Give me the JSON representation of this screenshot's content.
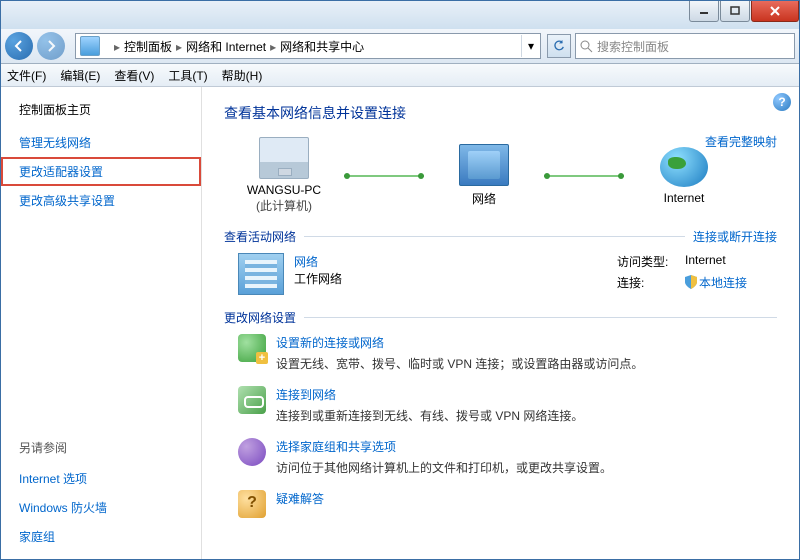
{
  "titlebar": {
    "min": "min",
    "max": "max",
    "close": "close"
  },
  "nav": {
    "crumbs": [
      "控制面板",
      "网络和 Internet",
      "网络和共享中心"
    ],
    "search_placeholder": "搜索控制面板"
  },
  "menu": {
    "file": "文件(F)",
    "edit": "编辑(E)",
    "view": "查看(V)",
    "tools": "工具(T)",
    "help": "帮助(H)"
  },
  "sidebar": {
    "home": "控制面板主页",
    "items": [
      "管理无线网络",
      "更改适配器设置",
      "更改高级共享设置"
    ],
    "seealso_header": "另请参阅",
    "seealso": [
      "Internet 选项",
      "Windows 防火墙",
      "家庭组"
    ]
  },
  "main": {
    "title": "查看基本网络信息并设置连接",
    "map_link": "查看完整映射",
    "nodes": {
      "pc": {
        "label": "WANGSU-PC",
        "sub": "(此计算机)"
      },
      "net": {
        "label": "网络"
      },
      "internet": {
        "label": "Internet"
      }
    },
    "active": {
      "header": "查看活动网络",
      "right_link": "连接或断开连接",
      "name": "网络",
      "type": "工作网络",
      "props": {
        "access_k": "访问类型:",
        "access_v": "Internet",
        "conn_k": "连接:",
        "conn_v": "本地连接"
      }
    },
    "change": {
      "header": "更改网络设置",
      "tasks": [
        {
          "name": "设置新的连接或网络",
          "desc": "设置无线、宽带、拨号、临时或 VPN 连接；或设置路由器或访问点。"
        },
        {
          "name": "连接到网络",
          "desc": "连接到或重新连接到无线、有线、拨号或 VPN 网络连接。"
        },
        {
          "name": "选择家庭组和共享选项",
          "desc": "访问位于其他网络计算机上的文件和打印机，或更改共享设置。"
        },
        {
          "name": "疑难解答",
          "desc": ""
        }
      ]
    }
  }
}
